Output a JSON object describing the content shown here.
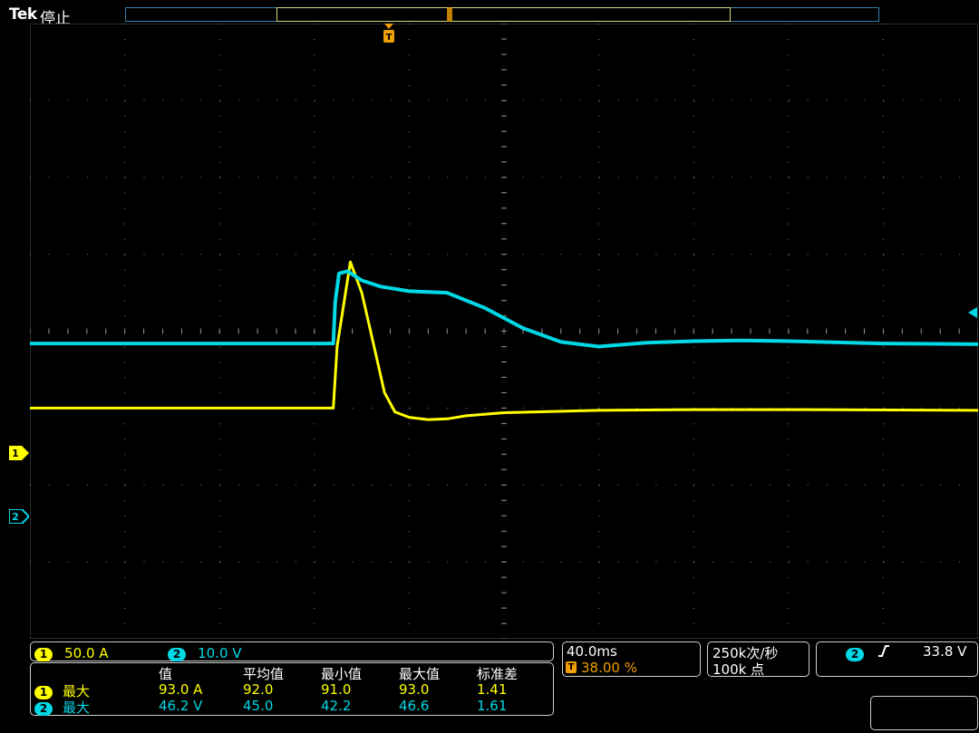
{
  "header": {
    "brand": "Tek",
    "status": "停止"
  },
  "trigger_marker": "T",
  "ch_markers": {
    "ch1": "1",
    "ch2": "2"
  },
  "scales": {
    "ch1": {
      "badge": "1",
      "value": "50.0 A"
    },
    "ch2": {
      "badge": "2",
      "value": "10.0 V"
    }
  },
  "measurements": {
    "headers": [
      "值",
      "平均值",
      "最小值",
      "最大值",
      "标准差"
    ],
    "rows": [
      {
        "badge": "1",
        "label": "最大",
        "values": [
          "93.0 A",
          "92.0",
          "91.0",
          "93.0",
          "1.41"
        ]
      },
      {
        "badge": "2",
        "label": "最大",
        "values": [
          "46.2 V",
          "45.0",
          "42.2",
          "46.6",
          "1.61"
        ]
      }
    ]
  },
  "timebase": {
    "scale": "40.0ms",
    "trigger_pos_icon": "T",
    "trigger_pos": "38.00 %"
  },
  "acquisition": {
    "rate": "250k次/秒",
    "points": "100k 点"
  },
  "trigger": {
    "badge": "2",
    "slope_icon": "rising-edge-icon",
    "level": "33.8 V"
  },
  "colors": {
    "ch1": "#ffff00",
    "ch2": "#00d8e6",
    "grid": "#8a8a8a",
    "trigger_marker": "#f0a000"
  },
  "chart_data": {
    "type": "line",
    "series": [
      {
        "color": "#ffff00",
        "x": [
          0,
          3.2,
          3.24,
          3.38,
          3.5,
          3.62,
          3.74,
          3.85,
          4.0,
          4.2,
          4.4,
          4.6,
          5.0,
          6.0,
          7.0,
          8.0,
          10.0
        ],
        "y": [
          -1.0,
          -1.0,
          -0.2,
          0.9,
          0.5,
          -0.15,
          -0.8,
          -1.05,
          -1.12,
          -1.15,
          -1.14,
          -1.1,
          -1.06,
          -1.03,
          -1.02,
          -1.02,
          -1.03
        ]
      },
      {
        "color": "#00d8e6",
        "x": [
          0,
          3.2,
          3.22,
          3.26,
          3.35,
          3.5,
          3.7,
          4.0,
          4.4,
          4.8,
          5.2,
          5.6,
          6.0,
          6.5,
          7.0,
          7.5,
          8.0,
          9.0,
          10.0
        ],
        "y": [
          -0.16,
          -0.16,
          0.38,
          0.75,
          0.78,
          0.66,
          0.58,
          0.52,
          0.5,
          0.3,
          0.04,
          -0.14,
          -0.2,
          -0.15,
          -0.13,
          -0.12,
          -0.13,
          -0.16,
          -0.17
        ]
      }
    ],
    "xlim": [
      0,
      10
    ],
    "ylim": [
      -4,
      4
    ],
    "grid": true
  }
}
